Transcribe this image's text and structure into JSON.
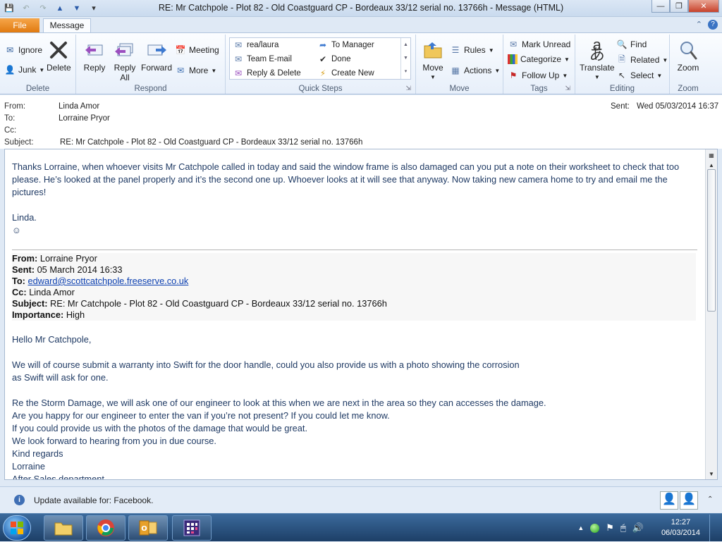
{
  "window": {
    "title": "RE: Mr Catchpole - Plot 82 - Old Coastguard CP - Bordeaux 33/12 serial no. 13766h  -  Message (HTML)"
  },
  "tabs": {
    "file": "File",
    "message": "Message"
  },
  "ribbon": {
    "delete_group": {
      "label": "Delete",
      "ignore": "Ignore",
      "junk": "Junk",
      "delete": "Delete"
    },
    "respond_group": {
      "label": "Respond",
      "reply": "Reply",
      "reply_all_1": "Reply",
      "reply_all_2": "All",
      "forward": "Forward",
      "meeting": "Meeting",
      "more": "More"
    },
    "quick_steps": {
      "label": "Quick Steps",
      "items": [
        "rea/laura",
        "To Manager",
        "Team E-mail",
        "Done",
        "Reply & Delete",
        "Create New"
      ]
    },
    "move_group": {
      "label": "Move",
      "move": "Move",
      "rules": "Rules",
      "actions": "Actions"
    },
    "tags_group": {
      "label": "Tags",
      "mark_unread": "Mark Unread",
      "categorize": "Categorize",
      "follow_up": "Follow Up"
    },
    "editing_group": {
      "label": "Editing",
      "translate": "Translate",
      "find": "Find",
      "related": "Related",
      "select": "Select"
    },
    "zoom_group": {
      "label": "Zoom",
      "zoom": "Zoom"
    }
  },
  "header": {
    "from_label": "From:",
    "from": "Linda Amor",
    "to_label": "To:",
    "to": "Lorraine Pryor",
    "cc_label": "Cc:",
    "subject_label": "Subject:",
    "subject": "RE: Mr Catchpole - Plot 82 - Old Coastguard CP - Bordeaux 33/12 serial no. 13766h",
    "sent_label": "Sent:",
    "sent": "Wed 05/03/2014 16:37"
  },
  "body": {
    "reply_para": "Thanks Lorraine, when whoever visits Mr Catchpole called in today and said the window frame is also damaged can you put a note on their worksheet to check that too please.  He’s looked at the panel properly and it’s the second one up.  Whoever looks at it will see that anyway. Now taking new camera home to try and email me the pictures!",
    "signoff": "Linda.",
    "smiley": "☺",
    "orig": {
      "from_label": "From:",
      "from": "Lorraine Pryor",
      "sent_label": "Sent:",
      "sent": "05 March 2014 16:33",
      "to_label": "To:",
      "to": "edward@scottcatchpole.freeserve.co.uk",
      "cc_label": "Cc:",
      "cc": "Linda Amor",
      "subject_label": "Subject:",
      "subject": "RE: Mr Catchpole - Plot 82 - Old Coastguard CP - Bordeaux 33/12 serial no. 13766h",
      "importance_label": "Importance:",
      "importance": "High"
    },
    "greeting": "Hello Mr Catchpole,",
    "para1_line1": "We will of course submit a warranty into Swift for the door handle, could you also provide us with a photo showing the corrosion",
    "para1_line2": "as Swift will ask for one.",
    "para2_line1": "Re the Storm Damage, we will ask one of our engineer to look at this when we are next in the area so they can accesses the damage.",
    "para2_line2": "Are you happy for our engineer to enter the van if you’re not present? If you could let me know.",
    "para2_line3": "If you could provide us with the photos of the damage that would be great.",
    "para2_line4": "We look forward to hearing from you in due course.",
    "closing": "Kind regards",
    "name": "Lorraine",
    "dept": "After Sales department"
  },
  "infobar": {
    "text": "Update available for: Facebook."
  },
  "taskbar": {
    "time": "12:27",
    "date": "06/03/2014"
  }
}
